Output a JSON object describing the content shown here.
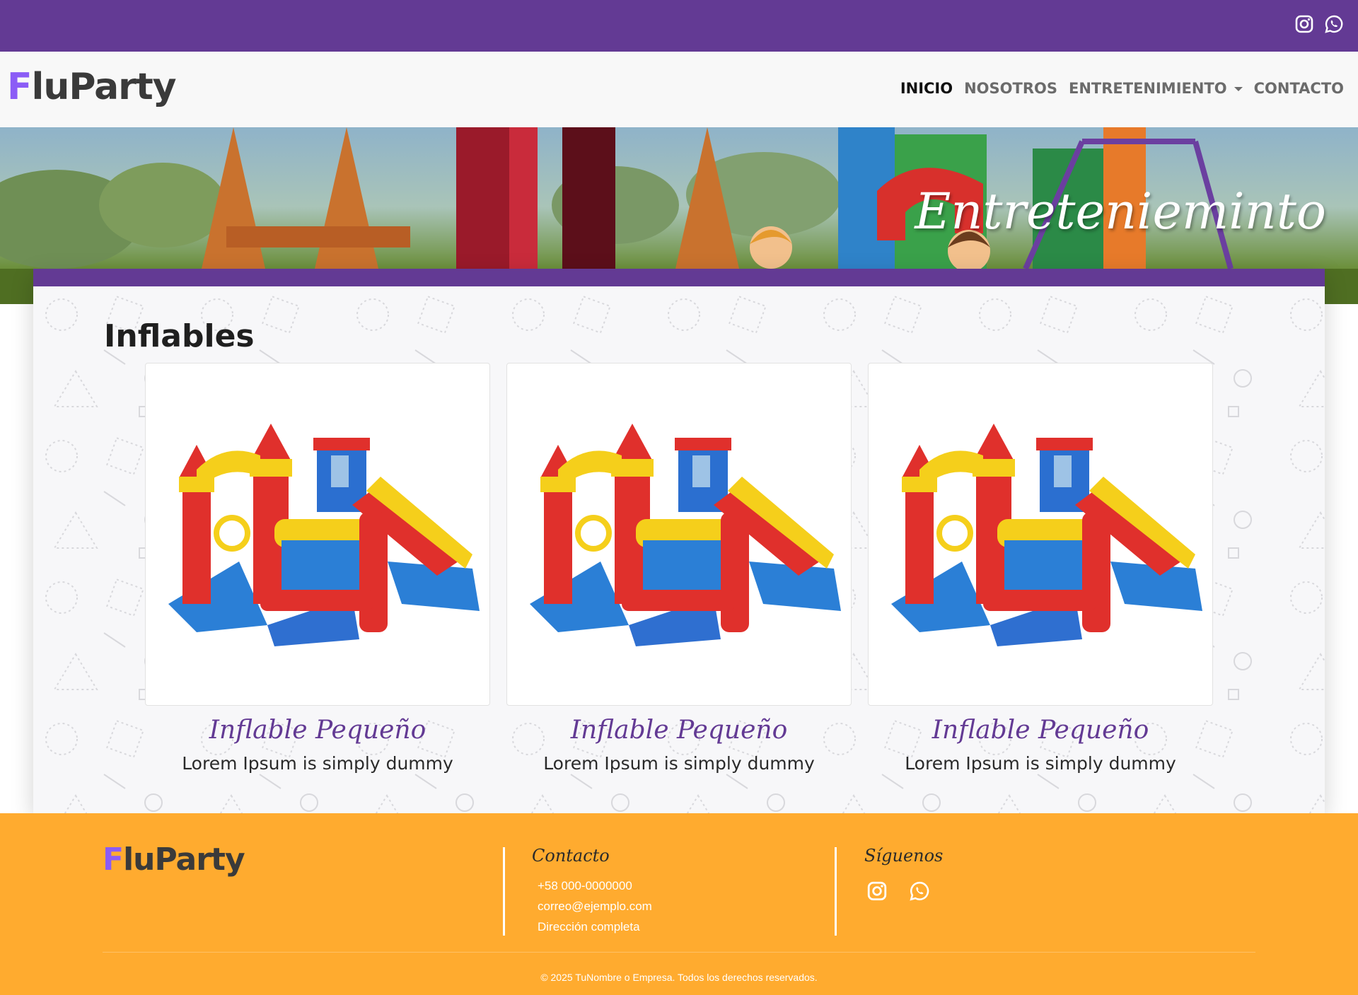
{
  "topbar": {
    "social_icons": [
      "instagram-icon",
      "whatsapp-icon"
    ],
    "color": "#633a94"
  },
  "brand": {
    "first_letter": "F",
    "rest": "luParty"
  },
  "nav": {
    "items": [
      {
        "label": "INICIO",
        "active": true
      },
      {
        "label": "NOSOTROS",
        "active": false
      },
      {
        "label": "ENTRETENIMIENTO",
        "active": false,
        "dropdown": true
      },
      {
        "label": "CONTACTO",
        "active": false
      }
    ]
  },
  "hero": {
    "title": "Entretenieminto"
  },
  "section": {
    "title": "Inflables"
  },
  "products": [
    {
      "name": "Inflable Pequeño",
      "description": "Lorem Ipsum is simply dummy"
    },
    {
      "name": "Inflable Pequeño",
      "description": "Lorem Ipsum is simply dummy"
    },
    {
      "name": "Inflable Pequeño",
      "description": "Lorem Ipsum is simply dummy"
    }
  ],
  "footer": {
    "contact_heading": "Contacto",
    "phone": "+58 000-0000000",
    "email": "correo@ejemplo.com",
    "address": "Dirección completa",
    "follow_heading": "Síguenos",
    "social_icons": [
      "instagram-icon",
      "whatsapp-icon"
    ],
    "copyright": "© 2025 TuNombre o Empresa. Todos los derechos reservados.",
    "color": "#ffab2f"
  }
}
